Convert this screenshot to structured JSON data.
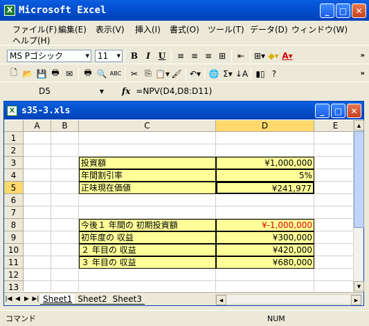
{
  "app": {
    "title": "Microsoft Excel",
    "icon_letter": "X"
  },
  "menu": [
    "ファイル(F)",
    "編集(E)",
    "表示(V)",
    "挿入(I)",
    "書式(O)",
    "ツール(T)",
    "データ(D)",
    "ウィンドウ(W)",
    "ヘルプ(H)"
  ],
  "format": {
    "font": "MS Pゴシック",
    "size": "11",
    "bold": "B",
    "italic": "I",
    "underline": "U"
  },
  "formula_bar": {
    "name_box": "D5",
    "fx": "fx",
    "formula": "=NPV(D4,D8:D11)"
  },
  "workbook": {
    "title": "s35-3.xls",
    "icon_letter": "X"
  },
  "columns": [
    "A",
    "B",
    "C",
    "D",
    "E"
  ],
  "rows": [
    "1",
    "2",
    "3",
    "4",
    "5",
    "6",
    "7",
    "8",
    "9",
    "10",
    "11",
    "12",
    "13"
  ],
  "cells": [
    {
      "row": 3,
      "label": "投資額",
      "value": "¥1,000,000",
      "red": false
    },
    {
      "row": 4,
      "label": "年間割引率",
      "value": "5%",
      "red": false
    },
    {
      "row": 5,
      "label": "正味現在価値",
      "value": "¥241,977",
      "red": false
    },
    {
      "row": 8,
      "label": "今後１ 年間の 初期投資額",
      "value": "¥-1,000,000",
      "red": true
    },
    {
      "row": 9,
      "label": "初年度の 収益",
      "value": "¥300,000",
      "red": false
    },
    {
      "row": 10,
      "label": "２ 年目の 収益",
      "value": "¥420,000",
      "red": false
    },
    {
      "row": 11,
      "label": "３ 年目の 収益",
      "value": "¥680,000",
      "red": false
    }
  ],
  "sheets": [
    "Sheet1",
    "Sheet2",
    "Sheet3"
  ],
  "status": {
    "mode": "コマンド",
    "num": "NUM"
  }
}
